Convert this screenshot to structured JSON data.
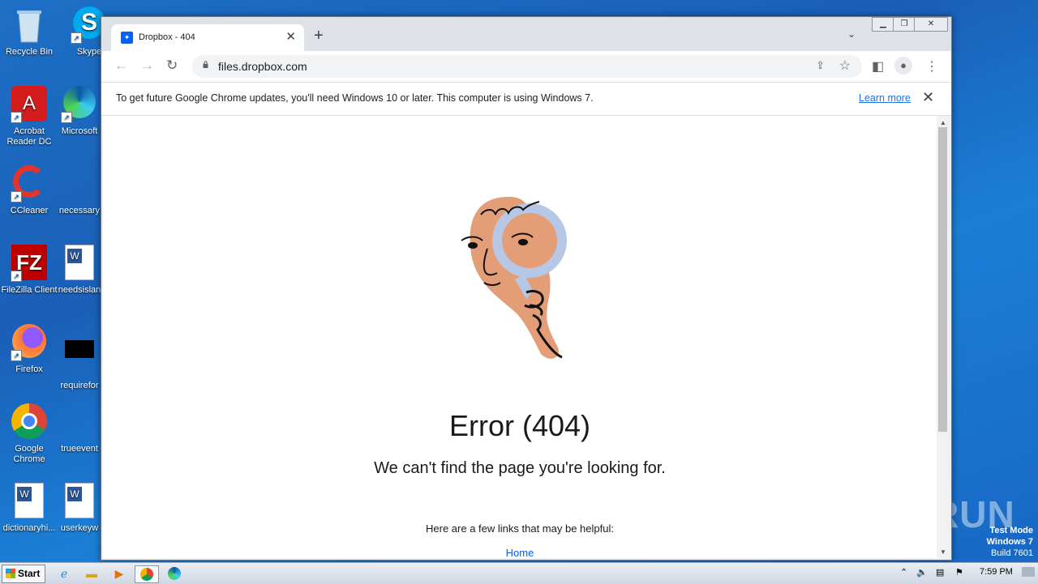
{
  "desktop": {
    "icons": [
      {
        "label": "Recycle Bin"
      },
      {
        "label": "Skype"
      },
      {
        "label": "Acrobat Reader DC"
      },
      {
        "label": "Microsoft"
      },
      {
        "label": "CCleaner"
      },
      {
        "label": "necessary"
      },
      {
        "label": "FileZilla Client"
      },
      {
        "label": "needsislan"
      },
      {
        "label": "Firefox"
      },
      {
        "label": "requirefor"
      },
      {
        "label": "Google Chrome"
      },
      {
        "label": "trueevent"
      },
      {
        "label": "dictionaryhi..."
      },
      {
        "label": "userkeyw"
      }
    ],
    "watermark": "ANY RUN",
    "test_mode": {
      "line1": "Test Mode",
      "line2": "Windows 7",
      "line3": "Build 7601"
    }
  },
  "browser": {
    "tab": {
      "title": "Dropbox - 404",
      "favicon": "dropbox-icon"
    },
    "address": "files.dropbox.com",
    "infobar": {
      "message": "To get future Google Chrome updates, you'll need Windows 10 or later. This computer is using Windows 7.",
      "link": "Learn more"
    }
  },
  "page": {
    "title": "Error (404)",
    "subtitle": "We can't find the page you're looking for.",
    "help_text": "Here are a few links that may be helpful:",
    "home_link": "Home"
  },
  "taskbar": {
    "start": "Start",
    "time": "7:59 PM"
  },
  "colors": {
    "dropbox_blue": "#0061fe",
    "skin": "#e39e78",
    "glass": "#b7c8e6",
    "desktop": "#1d6fc5"
  }
}
